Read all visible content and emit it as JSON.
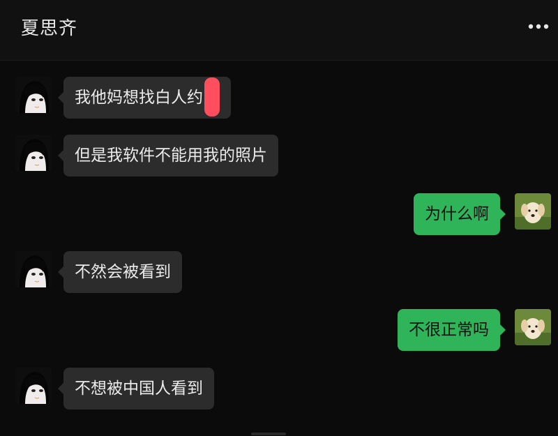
{
  "header": {
    "title": "夏思齐",
    "more_icon": "more-dots-icon"
  },
  "colors": {
    "background": "#0b0b0b",
    "incoming_bubble": "#2c2c2c",
    "outgoing_bubble": "#2fb45a",
    "redaction": "#ff4f5e"
  },
  "messages": [
    {
      "side": "incoming",
      "text": "我他妈想找白人约",
      "redacted_suffix": true
    },
    {
      "side": "incoming",
      "text": "但是我软件不能用我的照片"
    },
    {
      "side": "outgoing",
      "text": "为什么啊"
    },
    {
      "side": "incoming",
      "text": "不然会被看到"
    },
    {
      "side": "outgoing",
      "text": "不很正常吗"
    },
    {
      "side": "incoming",
      "text": "不想被中国人看到"
    }
  ],
  "avatars": {
    "contact": "anime-girl-avatar",
    "self": "puppy-avatar"
  }
}
